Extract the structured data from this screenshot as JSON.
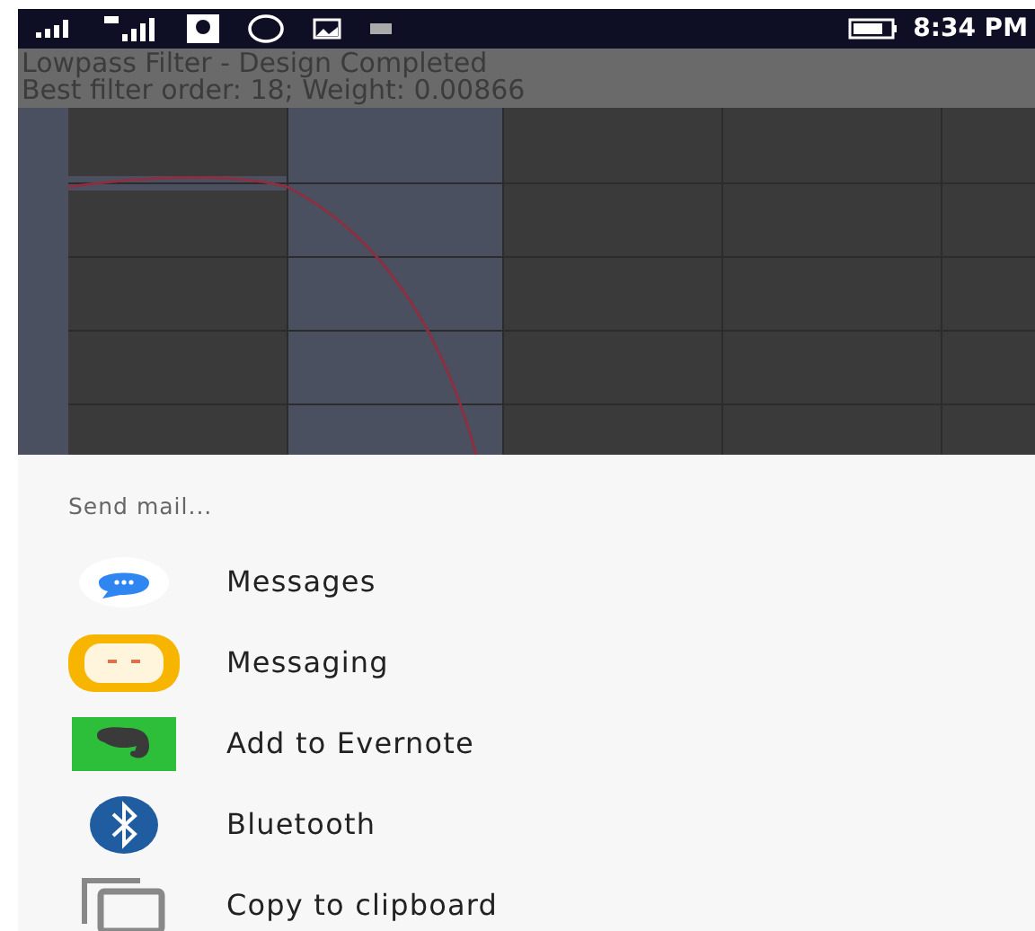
{
  "status_bar": {
    "time": "8:34 PM"
  },
  "header": {
    "title": "Lowpass Filter - Design Completed",
    "subtitle": "Best filter order: 18; Weight: 0.00866"
  },
  "share_sheet": {
    "title": "Send mail...",
    "items": [
      {
        "label": "Messages",
        "kind": "messages"
      },
      {
        "label": "Messaging",
        "kind": "messaging"
      },
      {
        "label": "Add to Evernote",
        "kind": "evernote"
      },
      {
        "label": "Bluetooth",
        "kind": "bluetooth"
      },
      {
        "label": "Copy to clipboard",
        "kind": "clipboard"
      }
    ]
  }
}
